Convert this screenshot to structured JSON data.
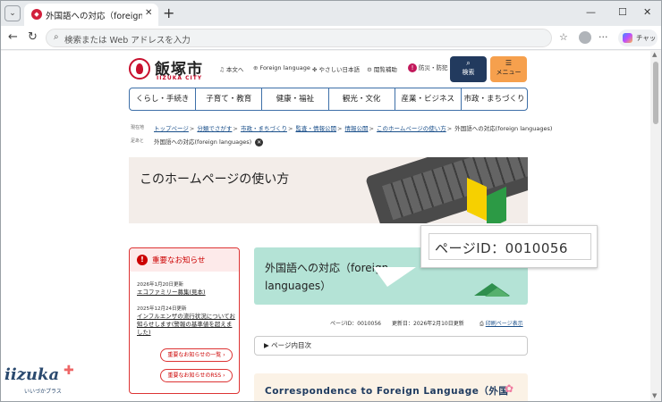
{
  "browser": {
    "tab_title": "外国語への対応（foreign language",
    "address_placeholder": "検索または Web アドレスを入力",
    "chat_label": "チャット"
  },
  "site": {
    "logo_name": "飯塚市",
    "logo_sub": "IIZUKA CITY",
    "utility_links": [
      {
        "icon": "sound-icon",
        "label": "本文へ"
      },
      {
        "icon": "globe-icon",
        "label": "Foreign language"
      },
      {
        "icon": "accessibility-icon",
        "label": "やさしい日本語"
      },
      {
        "icon": "gear-icon",
        "label": "閲覧補助"
      }
    ],
    "bosai_label": "防災・防犯",
    "search_label": "検索",
    "menu_label": "メニュー",
    "global_nav": [
      "くらし・手続き",
      "子育て・教育",
      "健康・福祉",
      "観光・文化",
      "産業・ビジネス",
      "市政・まちづくり"
    ]
  },
  "breadcrumb": {
    "label_current": "現在地",
    "label_trail": "足あと",
    "items": [
      "トップページ",
      "分類でさがす",
      "市政・まちづくり",
      "監査・情報公開",
      "情報公開",
      "このホームページの使い方"
    ],
    "current": "外国語への対応(foreign languages)",
    "trail_item": "外国語への対応(foreign languages)"
  },
  "hero_title": "このホームページの使い方",
  "notice": {
    "heading": "重要なお知らせ",
    "items": [
      {
        "date": "2026年1月20日更新",
        "title": "エコファミリー募集(見本)"
      },
      {
        "date": "2025年12月24日更新",
        "title": "インフルエンザの流行状況についてお知らせします(警報の基準値を超えました)"
      }
    ],
    "list_button": "重要なお知らせの一覧 ›",
    "rss_button": "重要なお知らせのRSS ›"
  },
  "page_title": "外国語への対応（foreign languages）",
  "callout_text": "ページID：0010056",
  "meta": {
    "page_id": "ページID：0010056",
    "updated": "更新日：2026年2月10日更新",
    "print": "印刷ページ表示"
  },
  "toc_label": "▶ ページ内目次",
  "section_heading": "Correspondence to Foreign Language（外国",
  "mascot": {
    "text": "iizuka",
    "sub": "いいづかプラス"
  }
}
